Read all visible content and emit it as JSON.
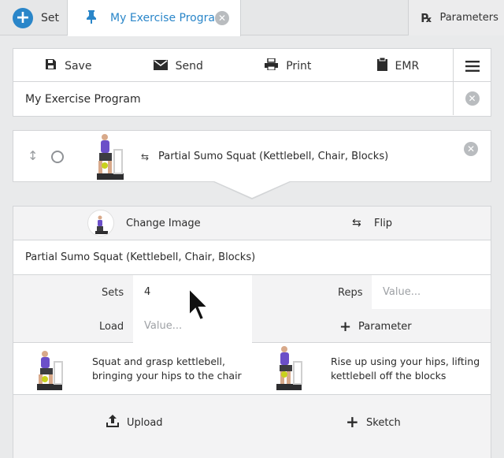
{
  "tabs": {
    "set_label": "Set",
    "program_label": "My Exercise Program",
    "parameters_label": "Parameters"
  },
  "toolbar": {
    "save": "Save",
    "send": "Send",
    "print": "Print",
    "emr": "EMR"
  },
  "program": {
    "title": "My Exercise Program"
  },
  "exercise": {
    "name": "Partial Sumo Squat (Kettlebell, Chair, Blocks)"
  },
  "editor": {
    "change_image": "Change Image",
    "flip": "Flip",
    "name_value": "Partial Sumo Squat (Kettlebell, Chair, Blocks)",
    "sets_label": "Sets",
    "sets_value": "4",
    "reps_label": "Reps",
    "reps_placeholder": "Value...",
    "load_label": "Load",
    "load_placeholder": "Value...",
    "parameter_label": "Parameter",
    "steps": [
      {
        "line1": "Squat and grasp kettlebell,",
        "line2": "bringing your hips to the chair"
      },
      {
        "line1": "Rise up using your hips, lifting",
        "line2": "kettlebell off the blocks"
      }
    ],
    "upload": "Upload",
    "sketch": "Sketch"
  },
  "colors": {
    "accent": "#2a86c9",
    "figure_shirt": "#6b4fc8",
    "figure_block": "#2e2e30"
  },
  "icons": [
    "plus-icon",
    "pin-icon",
    "close-icon",
    "rx-icon",
    "save-icon",
    "send-icon",
    "print-icon",
    "clipboard-icon",
    "menu-icon",
    "drag-handle-icon",
    "flip-icon",
    "upload-icon",
    "sketch-plus-icon",
    "cursor-icon"
  ]
}
